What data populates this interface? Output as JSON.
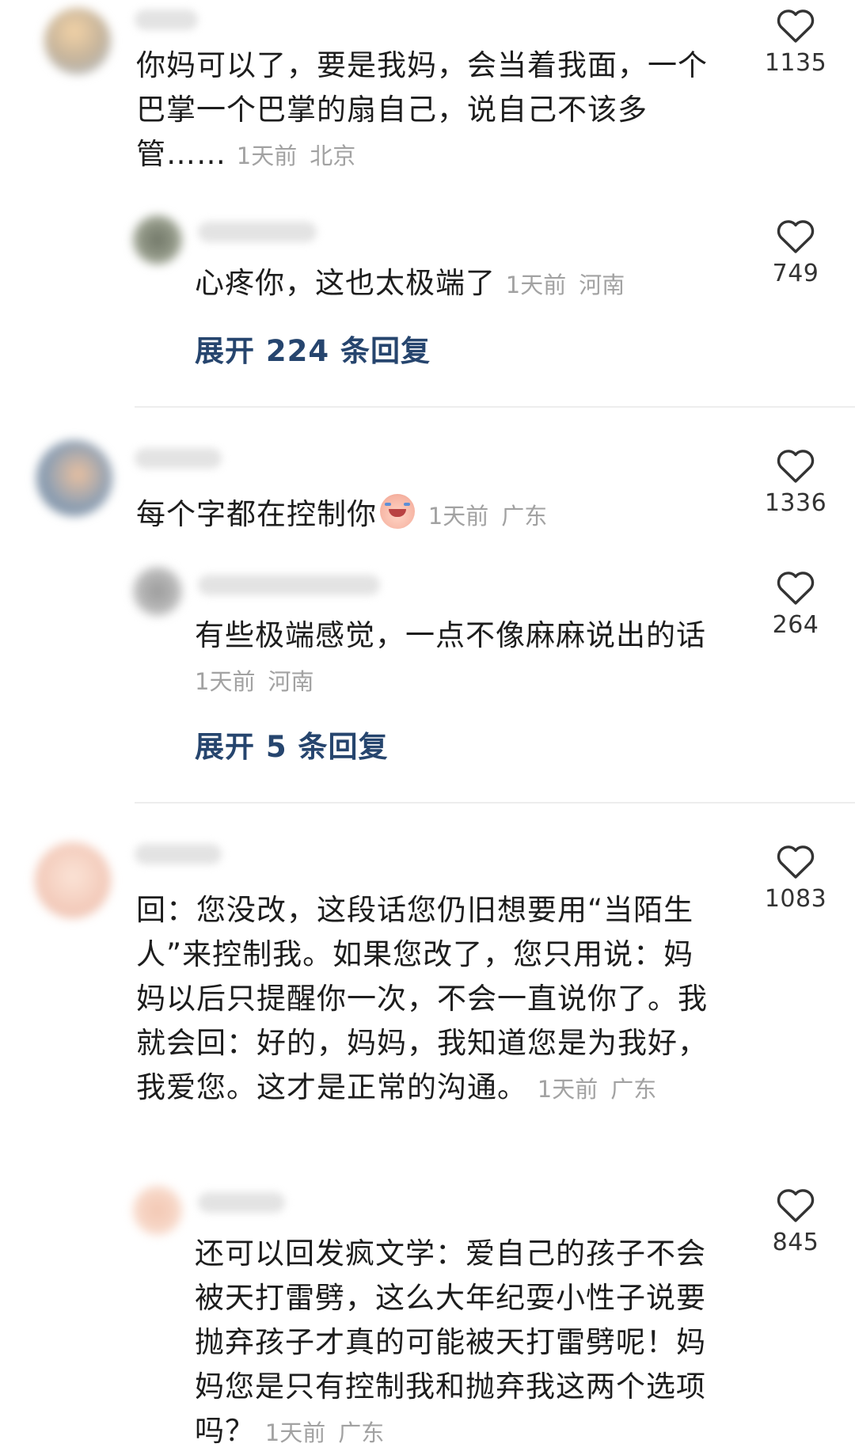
{
  "comments": [
    {
      "text": "你妈可以了，要是我妈，会当着我面，一个巴掌一个巴掌的扇自己，说自己不该多管……",
      "time": "1天前",
      "location": "北京",
      "likes": "1135",
      "reply": {
        "text": "心疼你，这也太极端了",
        "time": "1天前",
        "location": "河南",
        "likes": "749"
      },
      "expand_label": "展开 224 条回复"
    },
    {
      "text": "每个字都在控制你",
      "emoji": "crying-face-emoji",
      "time": "1天前",
      "location": "广东",
      "likes": "1336",
      "reply": {
        "text": "有些极端感觉，一点不像麻麻说出的话",
        "time": "1天前",
        "location": "河南",
        "likes": "264"
      },
      "expand_label": "展开 5 条回复"
    },
    {
      "text": "回：您没改，这段话您仍旧想要用“当陌生人”来控制我。如果您改了，您只用说：妈妈以后只提醒你一次，不会一直说你了。我就会回：好的，妈妈，我知道您是为我好，我爱您。这才是正常的沟通。",
      "time": "1天前",
      "location": "广东",
      "likes": "1083",
      "reply": {
        "text": "还可以回发疯文学：爱自己的孩子不会被天打雷劈，这么大年纪耍小性子说要抛弃孩子才真的可能被天打雷劈呢！妈妈您是只有控制我和抛弃我这两个选项吗？",
        "time": "1天前",
        "location": "广东",
        "likes": "845"
      }
    }
  ],
  "colors": {
    "text": "#1d1d1d",
    "meta": "#a2a2a2",
    "expand_link": "#26456e",
    "heart_outline": "#333333",
    "divider": "#ededed"
  },
  "icons": {
    "like": "heart-outline-icon"
  }
}
